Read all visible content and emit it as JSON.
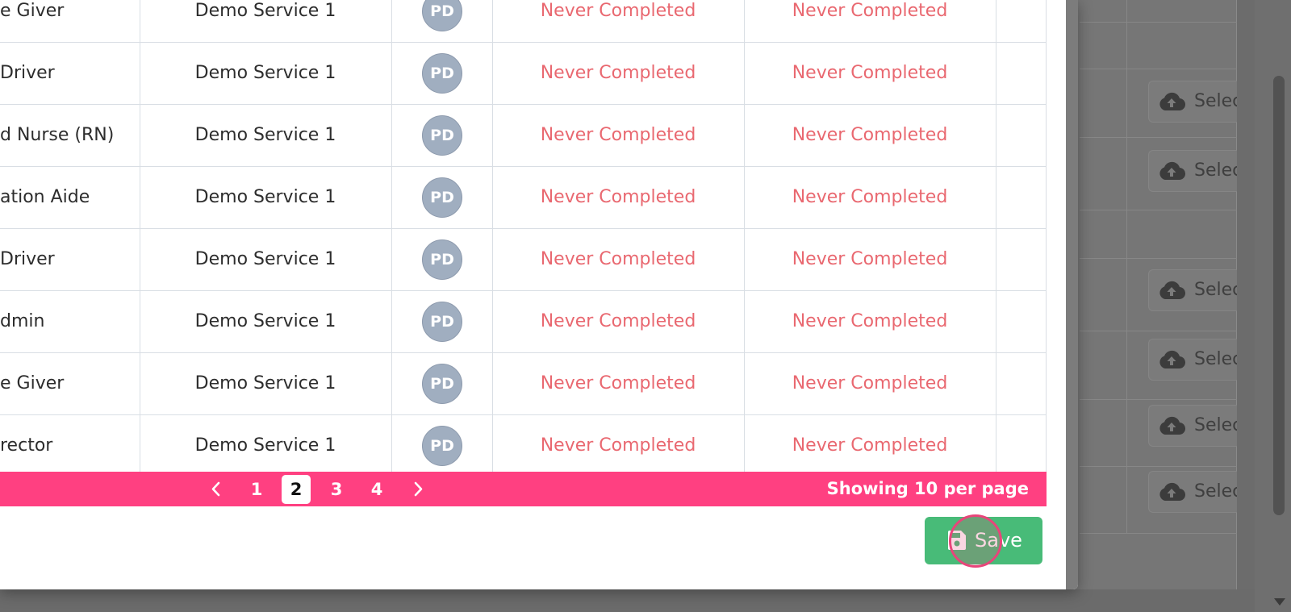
{
  "table": {
    "rows": [
      {
        "role": "e Giver",
        "service": "Demo Service 1",
        "avatar": "PD",
        "status1": "Never Completed",
        "status2": "Never Completed"
      },
      {
        "role": "Driver",
        "service": "Demo Service 1",
        "avatar": "PD",
        "status1": "Never Completed",
        "status2": "Never Completed"
      },
      {
        "role": "d Nurse (RN)",
        "service": "Demo Service 1",
        "avatar": "PD",
        "status1": "Never Completed",
        "status2": "Never Completed"
      },
      {
        "role": "ation Aide",
        "service": "Demo Service 1",
        "avatar": "PD",
        "status1": "Never Completed",
        "status2": "Never Completed"
      },
      {
        "role": "Driver",
        "service": "Demo Service 1",
        "avatar": "PD",
        "status1": "Never Completed",
        "status2": "Never Completed"
      },
      {
        "role": "dmin",
        "service": "Demo Service 1",
        "avatar": "PD",
        "status1": "Never Completed",
        "status2": "Never Completed"
      },
      {
        "role": "e Giver",
        "service": "Demo Service 1",
        "avatar": "PD",
        "status1": "Never Completed",
        "status2": "Never Completed"
      },
      {
        "role": "rector",
        "service": "Demo Service 1",
        "avatar": "PD",
        "status1": "Never Completed",
        "status2": "Never Completed"
      }
    ]
  },
  "pagination": {
    "pages": [
      "1",
      "2",
      "3",
      "4"
    ],
    "current": "2",
    "per_page_text": "Showing 10 per page"
  },
  "save_button": {
    "label": "Save"
  },
  "background": {
    "select_buttons": [
      "Selec",
      "Selec",
      "Selec",
      "Selec",
      "Selec",
      "Selec"
    ]
  },
  "colors": {
    "status_text": "#e96870",
    "pager_bar": "#ff4081",
    "save_button": "#48bb78",
    "avatar": "#a0aec0"
  }
}
